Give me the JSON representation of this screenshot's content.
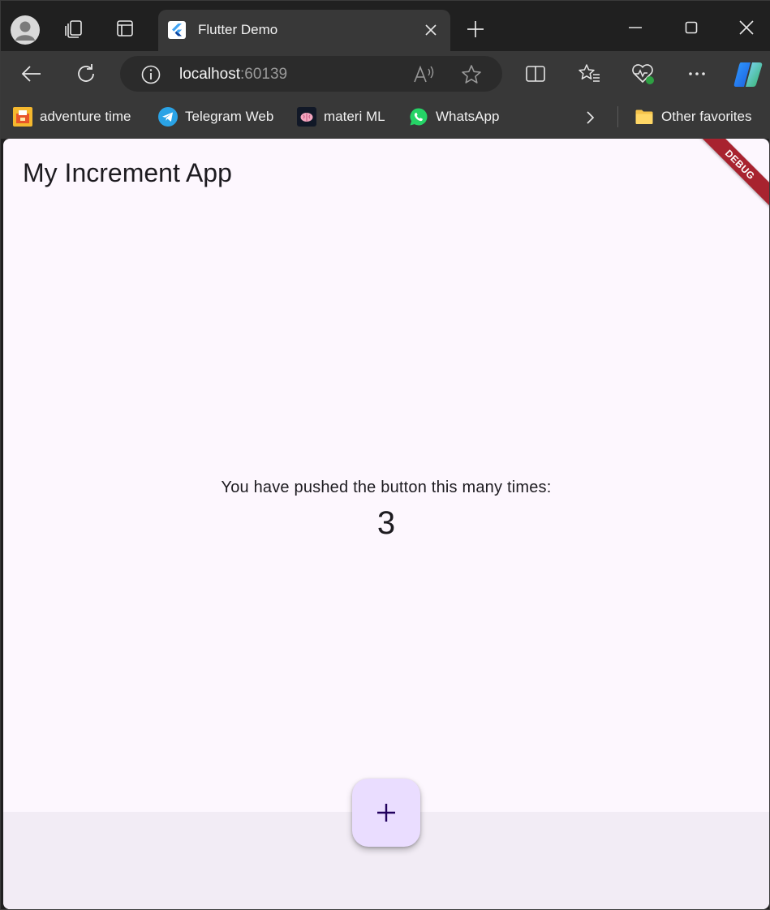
{
  "browser": {
    "tab": {
      "title": "Flutter Demo"
    },
    "address": {
      "host": "localhost",
      "port": ":60139"
    },
    "favorites": [
      {
        "label": "adventure time",
        "icon": "adventure-time-favicon"
      },
      {
        "label": "Telegram Web",
        "icon": "telegram-icon"
      },
      {
        "label": "materi ML",
        "icon": "brain-icon"
      },
      {
        "label": "WhatsApp",
        "icon": "whatsapp-icon"
      }
    ],
    "other_favorites": "Other favorites"
  },
  "app": {
    "title": "My Increment App",
    "debug_banner": "DEBUG",
    "counter_label": "You have pushed the button this many times:",
    "counter_value": "3",
    "fab_icon": "plus-icon"
  },
  "colors": {
    "page_background": "#fdf7fe",
    "bottom_area": "#f2ecf5",
    "fab_background": "#eaddff",
    "debug_banner": "#a8232f",
    "browser_chrome": "#383838"
  }
}
